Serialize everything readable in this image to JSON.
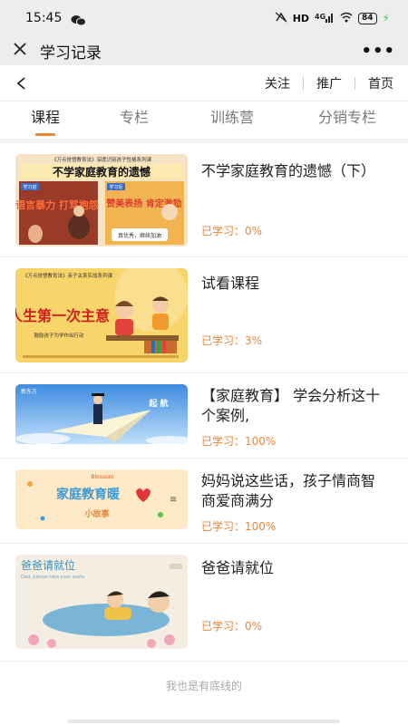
{
  "status_bar": {
    "time": "15:45",
    "network": "HD",
    "signal": "4G",
    "battery": "84"
  },
  "title_bar": {
    "title": "学习记录",
    "more": "•••"
  },
  "nav": {
    "follow": "关注",
    "promote": "推广",
    "home": "首页"
  },
  "tabs": [
    {
      "label": "课程",
      "active": true
    },
    {
      "label": "专栏",
      "active": false
    },
    {
      "label": "训练营",
      "active": false
    },
    {
      "label": "分销专栏",
      "active": false
    }
  ],
  "courses": [
    {
      "title": "不学家庭教育的遗憾（下）",
      "progress": "已学习：0%",
      "thumb": {
        "series": "《万点觉悟教育法》深度识别孩子性格系列课",
        "headline": "不学家庭教育的遗憾",
        "left_tag": "学习前",
        "right_tag": "学习后",
        "left_text": "语言暴力 打骂抱怨",
        "right_text": "赞美表扬 肯定激励",
        "bubble": "真优秀，继续加油"
      }
    },
    {
      "title": "试看课程",
      "progress": "已学习：3%",
      "thumb": {
        "series": "《万点觉悟教育法》亲子关系实战系列课",
        "headline": "人生第一次主意",
        "subline": "鼓励孩子为学作出行动"
      }
    },
    {
      "title": "【家庭教育】 学会分析这十个案例,",
      "progress": "已学习：100%",
      "thumb": {
        "logo": "新东方",
        "tagline": "起 航"
      }
    },
    {
      "title": "妈妈说这些话，孩子情商智商爱商满分",
      "progress": "已学习：100%",
      "thumb": {
        "brand": "Blossom",
        "headline": "家庭教育暖",
        "subline": "小故事"
      }
    },
    {
      "title": "爸爸请就位",
      "progress": "已学习：0%",
      "thumb": {
        "headline": "爸爸请就位",
        "subline": "Dad, please take your seats"
      }
    }
  ],
  "footer": "我也是有底线的"
}
